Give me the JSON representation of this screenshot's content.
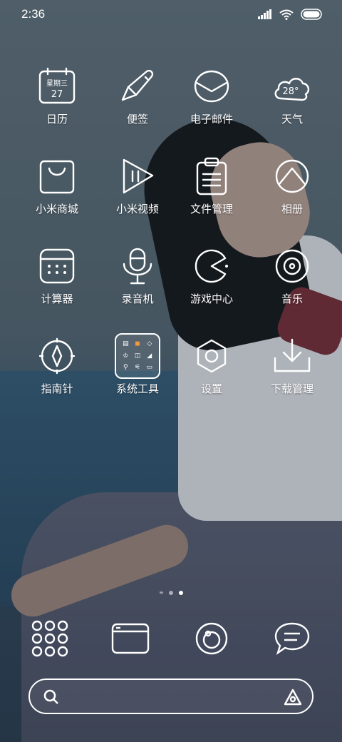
{
  "statusbar": {
    "time": "2:36",
    "battery_level": 1.0
  },
  "apps": [
    {
      "label": "日历",
      "icon": "calendar-icon",
      "icon_text_top": "星期三",
      "icon_text_bottom": "27"
    },
    {
      "label": "便签",
      "icon": "notes-icon"
    },
    {
      "label": "电子邮件",
      "icon": "email-icon"
    },
    {
      "label": "天气",
      "icon": "weather-icon",
      "icon_text": "28°"
    },
    {
      "label": "小米商城",
      "icon": "mall-bag-icon"
    },
    {
      "label": "小米视频",
      "icon": "video-icon"
    },
    {
      "label": "文件管理",
      "icon": "file-manager-icon"
    },
    {
      "label": "相册",
      "icon": "gallery-icon"
    },
    {
      "label": "计算器",
      "icon": "calculator-icon"
    },
    {
      "label": "录音机",
      "icon": "recorder-icon"
    },
    {
      "label": "游戏中心",
      "icon": "game-center-icon"
    },
    {
      "label": "音乐",
      "icon": "music-icon"
    },
    {
      "label": "指南针",
      "icon": "compass-icon"
    },
    {
      "label": "系统工具",
      "icon": "folder-icon"
    },
    {
      "label": "设置",
      "icon": "settings-icon"
    },
    {
      "label": "下载管理",
      "icon": "download-icon"
    }
  ],
  "pager": {
    "pages": 2,
    "active_index": 1
  },
  "dock": [
    {
      "icon": "app-drawer-icon"
    },
    {
      "icon": "browser-icon"
    },
    {
      "icon": "camera-icon"
    },
    {
      "icon": "messages-icon"
    }
  ],
  "search": {
    "placeholder": ""
  },
  "colors": {
    "foreground": "#ffffff"
  }
}
